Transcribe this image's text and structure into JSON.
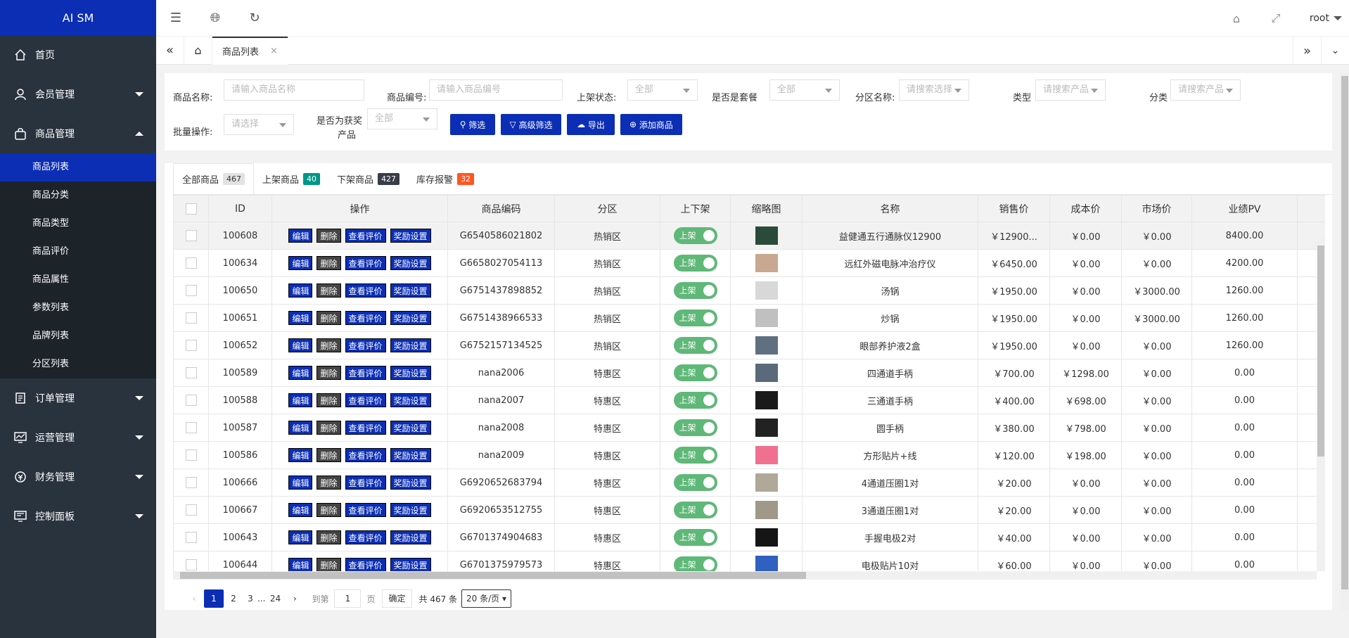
{
  "app": {
    "title": "AI SM",
    "user": "root"
  },
  "sidebar": {
    "items": [
      {
        "label": "首页",
        "icon": "home-icon"
      },
      {
        "label": "会员管理",
        "icon": "user-icon"
      },
      {
        "label": "商品管理",
        "icon": "bag-icon"
      },
      {
        "label": "订单管理",
        "icon": "order-icon"
      },
      {
        "label": "运营管理",
        "icon": "chart-icon"
      },
      {
        "label": "财务管理",
        "icon": "finance-icon"
      },
      {
        "label": "控制面板",
        "icon": "dashboard-icon"
      }
    ],
    "sub": [
      "商品列表",
      "商品分类",
      "商品类型",
      "商品评价",
      "商品属性",
      "参数列表",
      "品牌列表",
      "分区列表"
    ]
  },
  "tabs": {
    "current": "商品列表",
    "close": "×"
  },
  "filter": {
    "name_label": "商品名称:",
    "name_placeholder": "请输入商品名称",
    "code_label": "商品编号:",
    "code_placeholder": "请输入商品编号",
    "status_label": "上架状态:",
    "status_value": "全部",
    "combo_label": "是否是套餐",
    "combo_value": "全部",
    "zone_label": "分区名称:",
    "zone_placeholder": "请搜索选择",
    "type_label": "类型",
    "type_placeholder": "请搜索产品",
    "cat_label": "分类",
    "cat_placeholder": "请搜索产品",
    "batch_label": "批量操作:",
    "batch_placeholder": "请选择",
    "award_label1": "是否为获奖",
    "award_label2": "产品",
    "award_value": "全部",
    "btn_filter": "筛选",
    "btn_adv": "高级筛选",
    "btn_export": "导出",
    "btn_add": "添加商品"
  },
  "table_tabs": [
    {
      "label": "全部商品",
      "count": "467",
      "color": "#e2e2e2"
    },
    {
      "label": "上架商品",
      "count": "40",
      "color": "#009688"
    },
    {
      "label": "下架商品",
      "count": "427",
      "color": "#393d49"
    },
    {
      "label": "库存报警",
      "count": "32",
      "color": "#ff5722"
    }
  ],
  "columns": [
    "ID",
    "操作",
    "商品编码",
    "分区",
    "上下架",
    "缩略图",
    "名称",
    "销售价",
    "成本价",
    "市场价",
    "业绩PV"
  ],
  "actions": [
    "编辑",
    "删除",
    "查看评价",
    "奖励设置"
  ],
  "switch_label": "上架",
  "rows": [
    {
      "id": "100608",
      "code": "G6540586021802",
      "zone": "热销区",
      "name": "益健通五行通脉仪12900",
      "price": "￥12900...",
      "cost": "￥0.00",
      "market": "￥0.00",
      "pv": "8400.00",
      "thumb": "#2a4a3a"
    },
    {
      "id": "100634",
      "code": "G6658027054113",
      "zone": "热销区",
      "name": "远红外磁电脉冲治疗仪",
      "price": "￥6450.00",
      "cost": "￥0.00",
      "market": "￥0.00",
      "pv": "4200.00",
      "thumb": "#c8a890"
    },
    {
      "id": "100650",
      "code": "G6751437898852",
      "zone": "热销区",
      "name": "汤锅",
      "price": "￥1950.00",
      "cost": "￥0.00",
      "market": "￥3000.00",
      "pv": "1260.00",
      "thumb": "#d8d8d8"
    },
    {
      "id": "100651",
      "code": "G6751438966533",
      "zone": "热销区",
      "name": "炒锅",
      "price": "￥1950.00",
      "cost": "￥0.00",
      "market": "￥3000.00",
      "pv": "1260.00",
      "thumb": "#c0c0c0"
    },
    {
      "id": "100652",
      "code": "G6752157134525",
      "zone": "热销区",
      "name": "眼部养护液2盒",
      "price": "￥1950.00",
      "cost": "￥0.00",
      "market": "￥0.00",
      "pv": "1260.00",
      "thumb": "#607080"
    },
    {
      "id": "100589",
      "code": "nana2006",
      "zone": "特惠区",
      "name": "四通道手柄",
      "price": "￥700.00",
      "cost": "￥1298.00",
      "market": "￥0.00",
      "pv": "0.00",
      "thumb": "#5a6a7a"
    },
    {
      "id": "100588",
      "code": "nana2007",
      "zone": "特惠区",
      "name": "三通道手柄",
      "price": "￥400.00",
      "cost": "￥698.00",
      "market": "￥0.00",
      "pv": "0.00",
      "thumb": "#1a1a1a"
    },
    {
      "id": "100587",
      "code": "nana2008",
      "zone": "特惠区",
      "name": "圆手柄",
      "price": "￥380.00",
      "cost": "￥798.00",
      "market": "￥0.00",
      "pv": "0.00",
      "thumb": "#222222"
    },
    {
      "id": "100586",
      "code": "nana2009",
      "zone": "特惠区",
      "name": "方形贴片+线",
      "price": "￥120.00",
      "cost": "￥198.00",
      "market": "￥0.00",
      "pv": "0.00",
      "thumb": "#f07090"
    },
    {
      "id": "100666",
      "code": "G6920652683794",
      "zone": "特惠区",
      "name": "4通道压圈1对",
      "price": "￥20.00",
      "cost": "￥0.00",
      "market": "￥0.00",
      "pv": "0.00",
      "thumb": "#b0a898"
    },
    {
      "id": "100667",
      "code": "G6920653512755",
      "zone": "特惠区",
      "name": "3通道压圈1对",
      "price": "￥20.00",
      "cost": "￥0.00",
      "market": "￥0.00",
      "pv": "0.00",
      "thumb": "#a09888"
    },
    {
      "id": "100643",
      "code": "G6701374904683",
      "zone": "特惠区",
      "name": "手握电极2对",
      "price": "￥40.00",
      "cost": "￥0.00",
      "market": "￥0.00",
      "pv": "0.00",
      "thumb": "#151515"
    },
    {
      "id": "100644",
      "code": "G6701375979573",
      "zone": "特惠区",
      "name": "电极贴片10对",
      "price": "￥60.00",
      "cost": "￥0.00",
      "market": "￥0.00",
      "pv": "0.00",
      "thumb": "#3060c0"
    }
  ],
  "pager": {
    "pages": [
      "1",
      "2",
      "3",
      "...",
      "24"
    ],
    "goto": "到第",
    "page_input": "1",
    "page_unit": "页",
    "confirm": "确定",
    "total": "共 467 条",
    "size": "20 条/页"
  },
  "colors": {
    "accent": "#0b2eb5",
    "sidebar": "#28333e",
    "switch_on": "#5fb878"
  }
}
